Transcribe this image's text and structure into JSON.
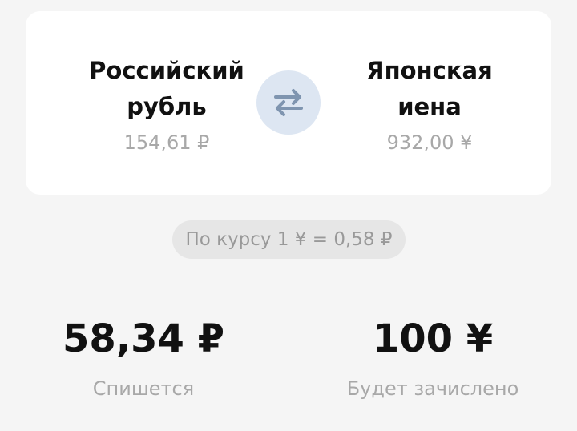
{
  "from_currency": {
    "name_line1": "Российский",
    "name_line2": "рубль",
    "balance": "154,61 ₽"
  },
  "to_currency": {
    "name_line1": "Японская",
    "name_line2": "иена",
    "balance": "932,00 ¥"
  },
  "swap_button": {
    "icon": "swap-arrows-icon"
  },
  "rate": {
    "text": "По курсу 1 ¥ = 0,58 ₽"
  },
  "debit": {
    "amount": "58,34 ₽",
    "label": "Спишется"
  },
  "credit": {
    "amount": "100 ¥",
    "label": "Будет зачислено"
  },
  "colors": {
    "page_background": "#f5f5f5",
    "card_background": "#ffffff",
    "swap_button_background": "#dde6f2",
    "swap_icon": "#7f95b0",
    "muted_text": "#a8a8a8",
    "rate_pill_background": "#e6e6e6"
  }
}
